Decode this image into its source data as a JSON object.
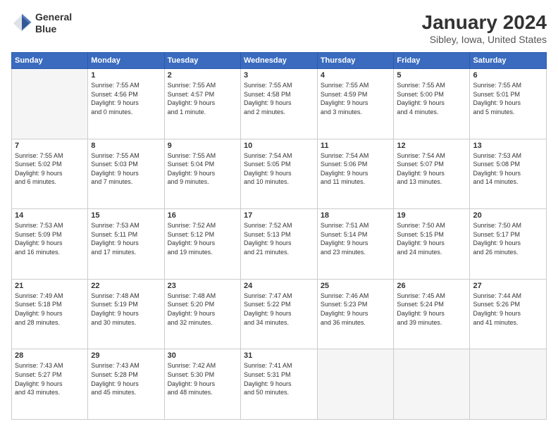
{
  "header": {
    "logo_line1": "General",
    "logo_line2": "Blue",
    "month": "January 2024",
    "location": "Sibley, Iowa, United States"
  },
  "days_of_week": [
    "Sunday",
    "Monday",
    "Tuesday",
    "Wednesday",
    "Thursday",
    "Friday",
    "Saturday"
  ],
  "weeks": [
    [
      {
        "num": "",
        "info": ""
      },
      {
        "num": "1",
        "info": "Sunrise: 7:55 AM\nSunset: 4:56 PM\nDaylight: 9 hours\nand 0 minutes."
      },
      {
        "num": "2",
        "info": "Sunrise: 7:55 AM\nSunset: 4:57 PM\nDaylight: 9 hours\nand 1 minute."
      },
      {
        "num": "3",
        "info": "Sunrise: 7:55 AM\nSunset: 4:58 PM\nDaylight: 9 hours\nand 2 minutes."
      },
      {
        "num": "4",
        "info": "Sunrise: 7:55 AM\nSunset: 4:59 PM\nDaylight: 9 hours\nand 3 minutes."
      },
      {
        "num": "5",
        "info": "Sunrise: 7:55 AM\nSunset: 5:00 PM\nDaylight: 9 hours\nand 4 minutes."
      },
      {
        "num": "6",
        "info": "Sunrise: 7:55 AM\nSunset: 5:01 PM\nDaylight: 9 hours\nand 5 minutes."
      }
    ],
    [
      {
        "num": "7",
        "info": "Sunrise: 7:55 AM\nSunset: 5:02 PM\nDaylight: 9 hours\nand 6 minutes."
      },
      {
        "num": "8",
        "info": "Sunrise: 7:55 AM\nSunset: 5:03 PM\nDaylight: 9 hours\nand 7 minutes."
      },
      {
        "num": "9",
        "info": "Sunrise: 7:55 AM\nSunset: 5:04 PM\nDaylight: 9 hours\nand 9 minutes."
      },
      {
        "num": "10",
        "info": "Sunrise: 7:54 AM\nSunset: 5:05 PM\nDaylight: 9 hours\nand 10 minutes."
      },
      {
        "num": "11",
        "info": "Sunrise: 7:54 AM\nSunset: 5:06 PM\nDaylight: 9 hours\nand 11 minutes."
      },
      {
        "num": "12",
        "info": "Sunrise: 7:54 AM\nSunset: 5:07 PM\nDaylight: 9 hours\nand 13 minutes."
      },
      {
        "num": "13",
        "info": "Sunrise: 7:53 AM\nSunset: 5:08 PM\nDaylight: 9 hours\nand 14 minutes."
      }
    ],
    [
      {
        "num": "14",
        "info": "Sunrise: 7:53 AM\nSunset: 5:09 PM\nDaylight: 9 hours\nand 16 minutes."
      },
      {
        "num": "15",
        "info": "Sunrise: 7:53 AM\nSunset: 5:11 PM\nDaylight: 9 hours\nand 17 minutes."
      },
      {
        "num": "16",
        "info": "Sunrise: 7:52 AM\nSunset: 5:12 PM\nDaylight: 9 hours\nand 19 minutes."
      },
      {
        "num": "17",
        "info": "Sunrise: 7:52 AM\nSunset: 5:13 PM\nDaylight: 9 hours\nand 21 minutes."
      },
      {
        "num": "18",
        "info": "Sunrise: 7:51 AM\nSunset: 5:14 PM\nDaylight: 9 hours\nand 23 minutes."
      },
      {
        "num": "19",
        "info": "Sunrise: 7:50 AM\nSunset: 5:15 PM\nDaylight: 9 hours\nand 24 minutes."
      },
      {
        "num": "20",
        "info": "Sunrise: 7:50 AM\nSunset: 5:17 PM\nDaylight: 9 hours\nand 26 minutes."
      }
    ],
    [
      {
        "num": "21",
        "info": "Sunrise: 7:49 AM\nSunset: 5:18 PM\nDaylight: 9 hours\nand 28 minutes."
      },
      {
        "num": "22",
        "info": "Sunrise: 7:48 AM\nSunset: 5:19 PM\nDaylight: 9 hours\nand 30 minutes."
      },
      {
        "num": "23",
        "info": "Sunrise: 7:48 AM\nSunset: 5:20 PM\nDaylight: 9 hours\nand 32 minutes."
      },
      {
        "num": "24",
        "info": "Sunrise: 7:47 AM\nSunset: 5:22 PM\nDaylight: 9 hours\nand 34 minutes."
      },
      {
        "num": "25",
        "info": "Sunrise: 7:46 AM\nSunset: 5:23 PM\nDaylight: 9 hours\nand 36 minutes."
      },
      {
        "num": "26",
        "info": "Sunrise: 7:45 AM\nSunset: 5:24 PM\nDaylight: 9 hours\nand 39 minutes."
      },
      {
        "num": "27",
        "info": "Sunrise: 7:44 AM\nSunset: 5:26 PM\nDaylight: 9 hours\nand 41 minutes."
      }
    ],
    [
      {
        "num": "28",
        "info": "Sunrise: 7:43 AM\nSunset: 5:27 PM\nDaylight: 9 hours\nand 43 minutes."
      },
      {
        "num": "29",
        "info": "Sunrise: 7:43 AM\nSunset: 5:28 PM\nDaylight: 9 hours\nand 45 minutes."
      },
      {
        "num": "30",
        "info": "Sunrise: 7:42 AM\nSunset: 5:30 PM\nDaylight: 9 hours\nand 48 minutes."
      },
      {
        "num": "31",
        "info": "Sunrise: 7:41 AM\nSunset: 5:31 PM\nDaylight: 9 hours\nand 50 minutes."
      },
      {
        "num": "",
        "info": ""
      },
      {
        "num": "",
        "info": ""
      },
      {
        "num": "",
        "info": ""
      }
    ]
  ]
}
